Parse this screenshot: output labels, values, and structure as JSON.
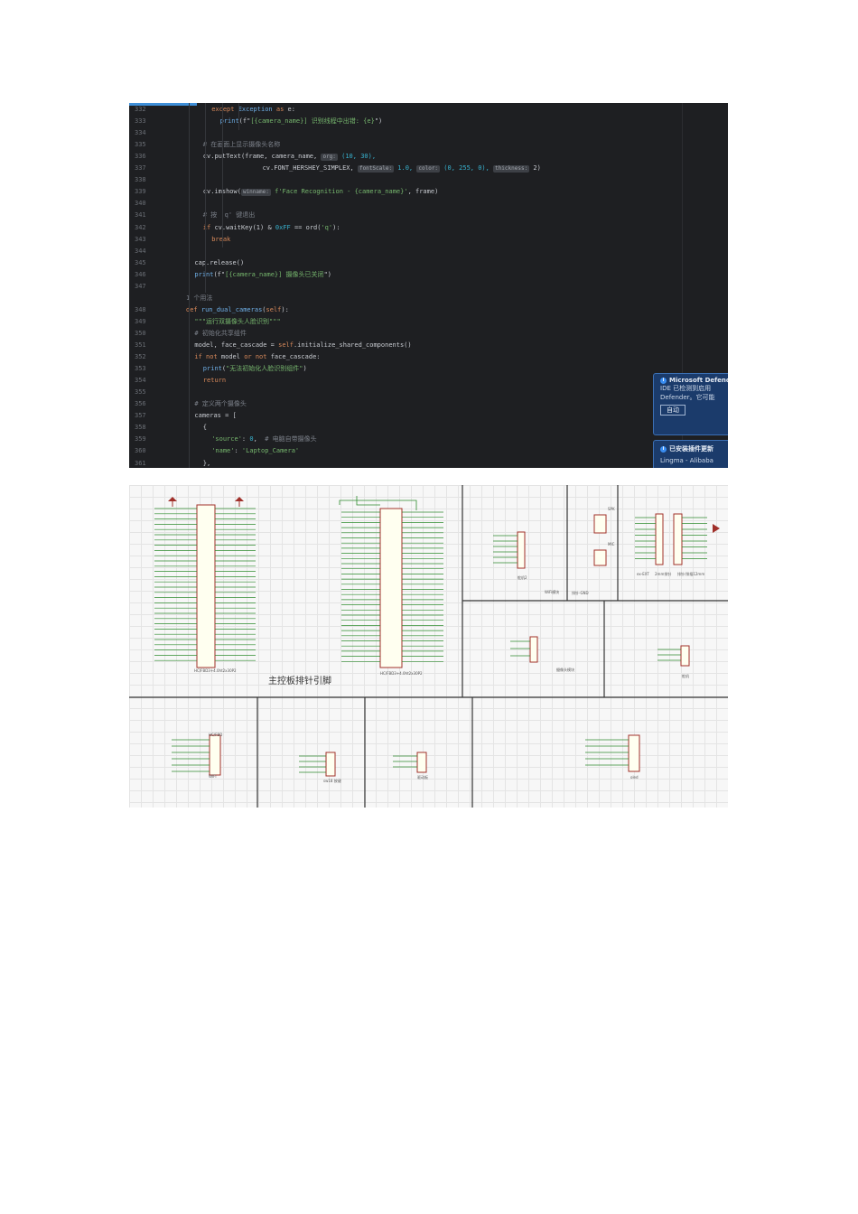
{
  "editor": {
    "accent_color": "#3f8fd8",
    "lines": [
      {
        "n": "332",
        "indent": 6,
        "parts": [
          {
            "t": "except ",
            "c": "kw"
          },
          {
            "t": "Exception ",
            "c": "fn"
          },
          {
            "t": "as ",
            "c": "kw"
          },
          {
            "t": "e:"
          }
        ]
      },
      {
        "n": "333",
        "indent": 7,
        "parts": [
          {
            "t": "print",
            "c": "fn"
          },
          {
            "t": "(f\""
          },
          {
            "t": "[{camera_name}] 识别线程中出错: {e}",
            "c": "str"
          },
          {
            "t": "\")"
          }
        ]
      },
      {
        "n": "334",
        "indent": 0,
        "parts": []
      },
      {
        "n": "335",
        "indent": 5,
        "parts": [
          {
            "t": "# 在画面上显示摄像头名称",
            "c": "cm"
          }
        ]
      },
      {
        "n": "336",
        "indent": 5,
        "parts": [
          {
            "t": "cv.putText(frame, camera_name, "
          },
          {
            "t": "org:",
            "h": true
          },
          {
            "t": " (10, 30),",
            "c": "num"
          }
        ]
      },
      {
        "n": "337",
        "indent": 12,
        "parts": [
          {
            "t": "cv.FONT_HERSHEY_SIMPLEX, "
          },
          {
            "t": "fontScale:",
            "h": true
          },
          {
            "t": " 1.0, ",
            "c": "num"
          },
          {
            "t": "color:",
            "h": true
          },
          {
            "t": " (0, 255, 0), ",
            "c": "num"
          },
          {
            "t": "thickness:",
            "h": true
          },
          {
            "t": " 2)"
          }
        ]
      },
      {
        "n": "338",
        "indent": 0,
        "parts": []
      },
      {
        "n": "339",
        "indent": 5,
        "parts": [
          {
            "t": "cv.imshow("
          },
          {
            "t": "winname:",
            "h": true
          },
          {
            "t": " f'Face Recognition - {camera_name}'",
            "c": "str"
          },
          {
            "t": ", frame)"
          }
        ]
      },
      {
        "n": "340",
        "indent": 0,
        "parts": []
      },
      {
        "n": "341",
        "indent": 5,
        "parts": [
          {
            "t": "# 按 'q' 键退出",
            "c": "cm"
          }
        ]
      },
      {
        "n": "342",
        "indent": 5,
        "parts": [
          {
            "t": "if ",
            "c": "kw"
          },
          {
            "t": "cv.waitKey(1) & "
          },
          {
            "t": "0xFF",
            "c": "num"
          },
          {
            "t": " == ord("
          },
          {
            "t": "'q'",
            "c": "str"
          },
          {
            "t": "):"
          }
        ]
      },
      {
        "n": "343",
        "indent": 6,
        "parts": [
          {
            "t": "break",
            "c": "kw"
          }
        ]
      },
      {
        "n": "344",
        "indent": 0,
        "parts": []
      },
      {
        "n": "345",
        "indent": 4,
        "parts": [
          {
            "t": "cap.release()"
          }
        ]
      },
      {
        "n": "346",
        "indent": 4,
        "parts": [
          {
            "t": "print",
            "c": "fn"
          },
          {
            "t": "(f\""
          },
          {
            "t": "[{camera_name}] 摄像头已关闭",
            "c": "str"
          },
          {
            "t": "\")"
          }
        ]
      },
      {
        "n": "347",
        "indent": 0,
        "parts": []
      },
      {
        "n": "",
        "indent": 3,
        "parts": [
          {
            "t": "1 个用法",
            "c": "cm"
          }
        ]
      },
      {
        "n": "348",
        "indent": 3,
        "parts": [
          {
            "t": "def ",
            "c": "kw"
          },
          {
            "t": "run_dual_cameras",
            "c": "fn"
          },
          {
            "t": "("
          },
          {
            "t": "self",
            "c": "kw"
          },
          {
            "t": "):"
          }
        ]
      },
      {
        "n": "349",
        "indent": 4,
        "parts": [
          {
            "t": "\"\"\"运行双摄像头人脸识别\"\"\"",
            "c": "str"
          }
        ]
      },
      {
        "n": "350",
        "indent": 4,
        "parts": [
          {
            "t": "# 初始化共享组件",
            "c": "cm"
          }
        ]
      },
      {
        "n": "351",
        "indent": 4,
        "parts": [
          {
            "t": "model, face_cascade = "
          },
          {
            "t": "self",
            "c": "kw"
          },
          {
            "t": ".initialize_shared_components()"
          }
        ]
      },
      {
        "n": "352",
        "indent": 4,
        "parts": [
          {
            "t": "if not ",
            "c": "kw"
          },
          {
            "t": "model "
          },
          {
            "t": "or not ",
            "c": "kw"
          },
          {
            "t": "face_cascade:"
          }
        ]
      },
      {
        "n": "353",
        "indent": 5,
        "parts": [
          {
            "t": "print",
            "c": "fn"
          },
          {
            "t": "("
          },
          {
            "t": "\"无法初始化人脸识别组件\"",
            "c": "str"
          },
          {
            "t": ")"
          }
        ]
      },
      {
        "n": "354",
        "indent": 5,
        "parts": [
          {
            "t": "return",
            "c": "kw"
          }
        ]
      },
      {
        "n": "355",
        "indent": 0,
        "parts": []
      },
      {
        "n": "356",
        "indent": 4,
        "parts": [
          {
            "t": "# 定义两个摄像头",
            "c": "cm"
          }
        ]
      },
      {
        "n": "357",
        "indent": 4,
        "parts": [
          {
            "t": "cameras = ["
          }
        ]
      },
      {
        "n": "358",
        "indent": 5,
        "parts": [
          {
            "t": "{"
          }
        ]
      },
      {
        "n": "359",
        "indent": 6,
        "parts": [
          {
            "t": "'source'",
            "c": "str"
          },
          {
            "t": ": "
          },
          {
            "t": "0",
            "c": "num"
          },
          {
            "t": ",  "
          },
          {
            "t": "# 电脑自带摄像头",
            "c": "cm"
          }
        ]
      },
      {
        "n": "360",
        "indent": 6,
        "parts": [
          {
            "t": "'name'",
            "c": "str"
          },
          {
            "t": ": "
          },
          {
            "t": "'Laptop_Camera'",
            "c": "str"
          }
        ]
      },
      {
        "n": "361",
        "indent": 5,
        "parts": [
          {
            "t": "},"
          }
        ]
      }
    ],
    "notifications": [
      {
        "title": "Microsoft Defender",
        "body": "IDE 已检测到启用",
        "body2": "Defender。它可能",
        "button": "自动"
      },
      {
        "title": "已安装插件更新",
        "body": "Lingma - Alibaba"
      }
    ]
  },
  "schematic": {
    "main_title": "主控板排针引脚",
    "labels": [
      "HC/FBD3+4.0ht2x30P2",
      "HC/FBD3+4.0ht2x30P2",
      "WiFi模块",
      "排针-GND",
      "ex-EXT",
      "2mm排针",
      "排针/排插12mm",
      "摄像头模块",
      "SPK",
      "MIC",
      "舵机",
      "WIFI",
      "HC/FBD",
      "sw18 按键",
      "驱动板",
      "oled",
      "舵机2"
    ]
  }
}
